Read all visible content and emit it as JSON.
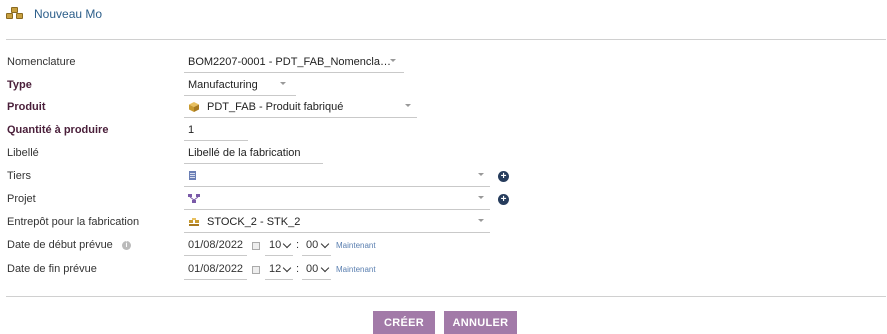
{
  "header": {
    "title": "Nouveau Mo",
    "icon": "boxes-icon"
  },
  "form": {
    "nomenclature": {
      "label": "Nomenclature",
      "value": "BOM2207-0001 - PDT_FAB_Nomencla…"
    },
    "type": {
      "label": "Type",
      "value": "Manufacturing"
    },
    "produit": {
      "label": "Produit",
      "value": "PDT_FAB - Produit fabriqué"
    },
    "quantite": {
      "label": "Quantité à produire",
      "value": "1"
    },
    "libelle": {
      "label": "Libellé",
      "value": "Libellé de la fabrication"
    },
    "tiers": {
      "label": "Tiers",
      "value": ""
    },
    "projet": {
      "label": "Projet",
      "value": ""
    },
    "entrepot": {
      "label": "Entrepôt pour la fabrication",
      "value": "STOCK_2 - STK_2"
    },
    "date_debut": {
      "label": "Date de début prévue",
      "date": "01/08/2022",
      "hour": "10",
      "minute": "00",
      "now_label": "Maintenant"
    },
    "date_fin": {
      "label": "Date de fin prévue",
      "date": "01/08/2022",
      "hour": "12",
      "minute": "00",
      "now_label": "Maintenant"
    }
  },
  "buttons": {
    "create": "CRÉER",
    "cancel": "ANNULER"
  },
  "colors": {
    "button": "#a27aa8",
    "required_label": "#4a1f3a",
    "link": "#5a7fb0",
    "header": "#2c5e8a"
  }
}
